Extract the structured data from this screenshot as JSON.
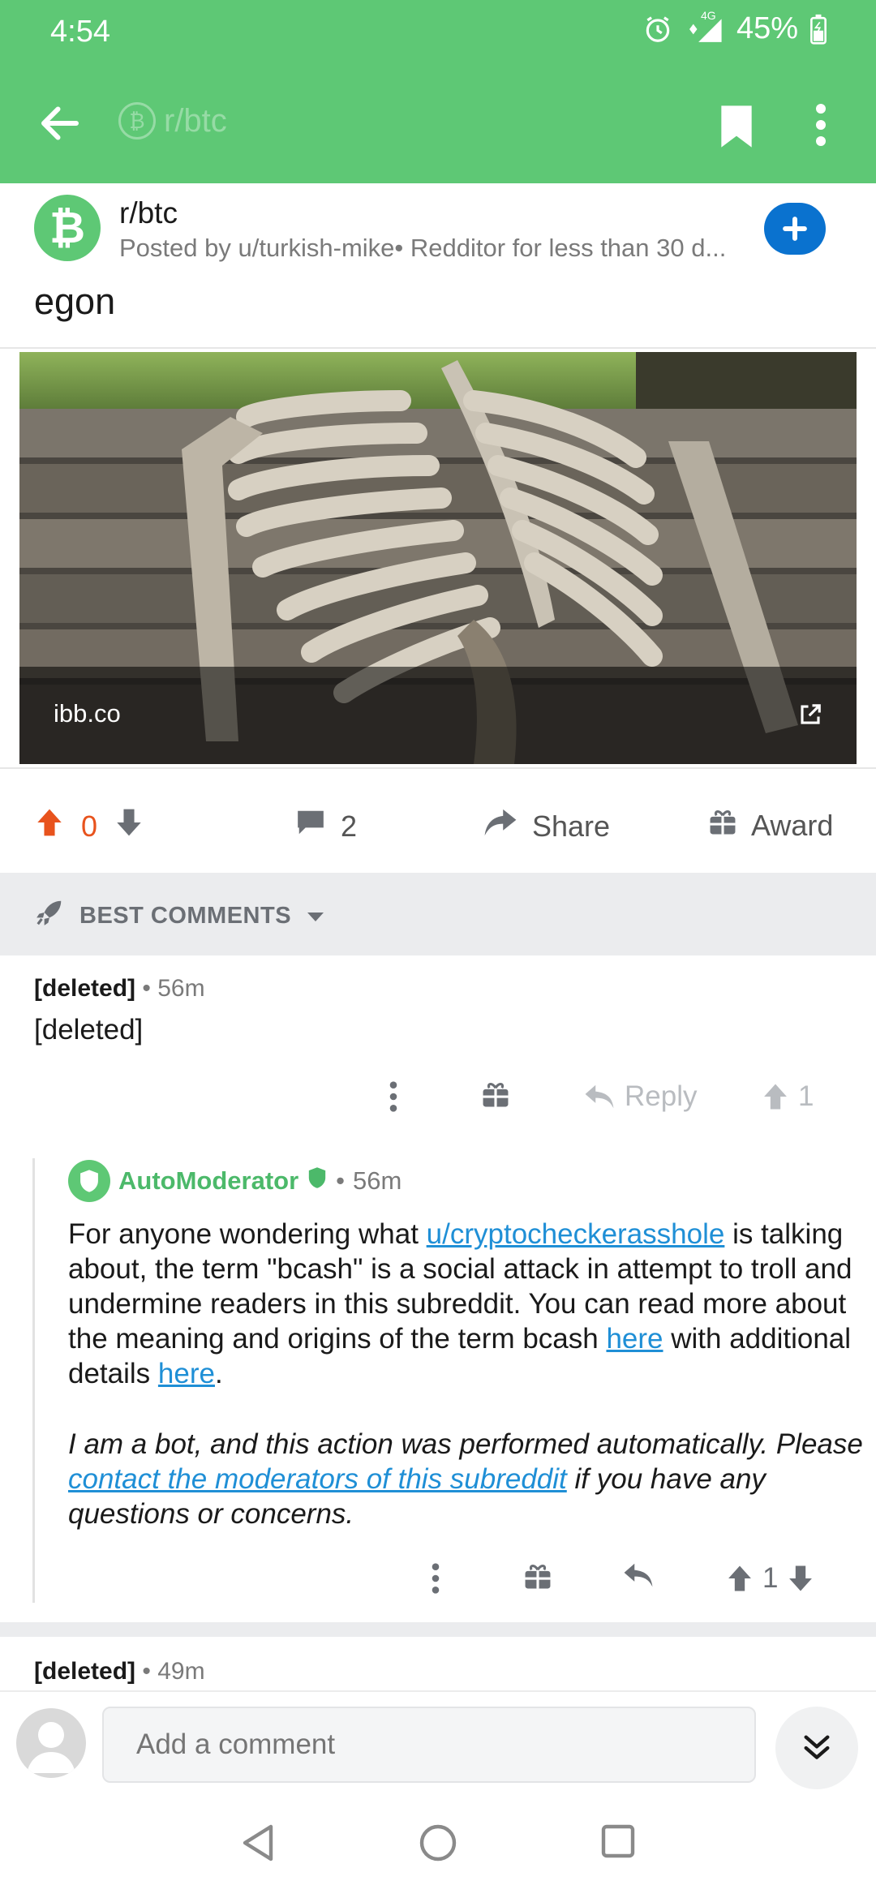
{
  "status_bar": {
    "time": "4:54",
    "battery": "45%",
    "network": "4G"
  },
  "app_bar": {
    "title": "r/btc"
  },
  "post": {
    "subreddit": "r/btc",
    "posted_by": "Posted by u/turkish-mike• Redditor for less than 30 d...",
    "title": "egon",
    "link_domain": "ibb.co",
    "score": "0",
    "comment_count": "2",
    "share_label": "Share",
    "award_label": "Award"
  },
  "sort": {
    "label": "BEST COMMENTS"
  },
  "comments": [
    {
      "author": "[deleted]",
      "age": "56m",
      "body": "[deleted]",
      "reply_label": "Reply",
      "score": "1"
    },
    {
      "author": "AutoModerator",
      "age": "56m",
      "body_part1": "For anyone wondering what ",
      "mention": "u/cryptocheckerasshole",
      "body_part2": " is talking about, the term \"bcash\" is a social attack in attempt to troll and undermine readers in this subreddit. You can read more about the meaning and origins of the term bcash ",
      "link1": "here",
      "body_part3": " with additional details ",
      "link2": "here",
      "body_part4": ".",
      "bot_part1": "I am a bot, and this action was performed automatically. Please ",
      "bot_link": "contact the moderators of this subreddit",
      "bot_part2": " if you have any questions or concerns.",
      "score": "1"
    },
    {
      "author": "[deleted]",
      "age": "49m"
    }
  ],
  "composer": {
    "placeholder": "Add a comment"
  },
  "colors": {
    "brand_green": "#5ec875",
    "upvote_orange": "#e8531d",
    "link_blue": "#1f8fd6",
    "join_blue": "#0a72cf"
  }
}
